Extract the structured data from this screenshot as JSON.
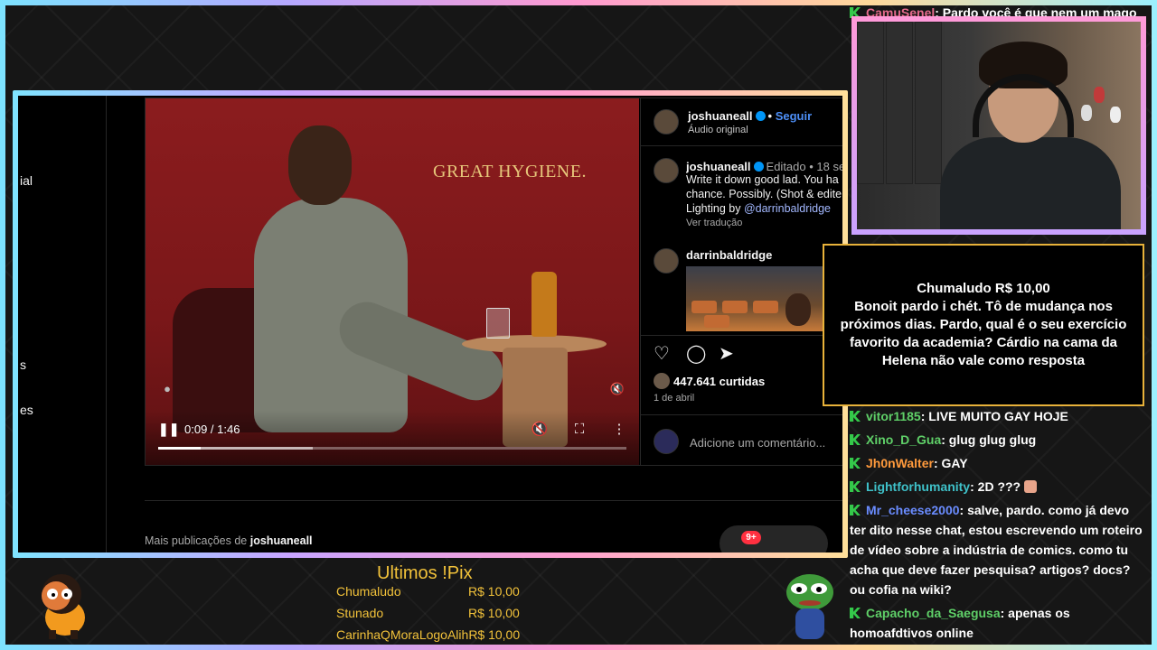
{
  "chat_top": {
    "user": "CamuSenel",
    "text": ": Pardo você é que nem um mago",
    "user_color": "#e46a8c"
  },
  "nav": {
    "items": [
      "ial",
      "s",
      "es"
    ]
  },
  "post": {
    "headline": "GREAT HYGIENE.",
    "author": "joshuaneall",
    "follow_sep": "•",
    "follow": "Seguir",
    "audio": "Áudio original",
    "caption_author": "joshuaneall",
    "caption_meta": "Editado • 18 se",
    "caption_lines": [
      "Write it down good lad. You ha",
      "chance. Possibly. (Shot & edite",
      "Lighting by "
    ],
    "caption_mention": "@darrinbaldridge",
    "see_translation": "Ver tradução",
    "commenter": "darrinbaldridge",
    "likes": "447.641 curtidas",
    "date": "1 de abril",
    "comment_placeholder": "Adicione um comentário...",
    "more_posts_prefix": "Mais publicações de",
    "more_posts_user": "joshuaneall",
    "notif_badge": "9+"
  },
  "video": {
    "time": "0:09 / 1:46",
    "progress_fraction": 0.09,
    "buffer_fraction": 0.33,
    "icons": [
      "pause-icon",
      "mute-icon",
      "fullscreen-icon",
      "more-icon"
    ]
  },
  "alert": {
    "title": "Chumaludo R$ 10,00",
    "message": "Bonoit pardo i chét. Tô de mudança nos próximos dias. Pardo, qual é o seu exercício favorito da academia? Cárdio na cama da Helena não vale como resposta"
  },
  "chat": [
    {
      "user": "vitor1185",
      "color": "#5fd068",
      "text": ": LIVE MUITO GAY HOJE"
    },
    {
      "user": "Xino_D_Gua",
      "color": "#5fd068",
      "text": ": glug glug glug"
    },
    {
      "user": "Jh0nWalter",
      "color": "#ff9a3c",
      "text": ": GAY"
    },
    {
      "user": "Lightforhumanity",
      "color": "#3fc1c9",
      "text": ": 2D ???"
    },
    {
      "user": "Mr_cheese2000",
      "color": "#6a8cff",
      "text": ": salve, pardo. como já devo ter dito nesse chat, estou escrevendo um roteiro de vídeo sobre a indústria de comics. como tu acha que deve fazer pesquisa? artigos? docs? ou cofia na wiki?"
    },
    {
      "user": "Capacho_da_Saegusa",
      "color": "#5fd068",
      "text": ": apenas os homoafdtivos online"
    }
  ],
  "pix": {
    "title": "Ultimos !Pix",
    "rows": [
      {
        "name": "Chumaludo",
        "amount": "R$ 10,00"
      },
      {
        "name": "Stunado",
        "amount": "R$ 10,00"
      },
      {
        "name": "CarinhaQMoraLogoAlih",
        "amount": "R$ 10,00"
      }
    ]
  }
}
